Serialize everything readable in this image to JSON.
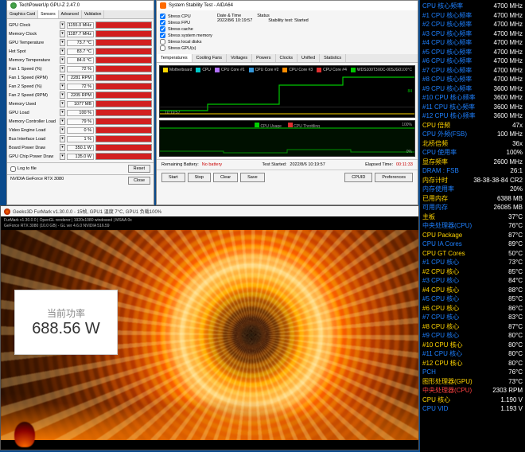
{
  "gpuz": {
    "title": "TechPowerUp GPU-Z 2.47.0",
    "tabs": [
      "Graphics Card",
      "Sensors",
      "Advanced",
      "Validation"
    ],
    "active_tab": 1,
    "rows": [
      {
        "label": "GPU Clock",
        "value": "1155.0 MHz"
      },
      {
        "label": "Memory Clock",
        "value": "1187.7 MHz"
      },
      {
        "label": "GPU Temperature",
        "value": "73.7 °C"
      },
      {
        "label": "Hot Spot",
        "value": "83.7 °C"
      },
      {
        "label": "Memory Temperature",
        "value": "84.0 °C"
      },
      {
        "label": "Fan 1 Speed (%)",
        "value": "72 %"
      },
      {
        "label": "Fan 1 Speed (RPM)",
        "value": "2281 RPM"
      },
      {
        "label": "Fan 2 Speed (%)",
        "value": "72 %"
      },
      {
        "label": "Fan 2 Speed (RPM)",
        "value": "2205 RPM"
      },
      {
        "label": "Memory Used",
        "value": "1077 MB"
      },
      {
        "label": "GPU Load",
        "value": "100 %"
      },
      {
        "label": "Memory Controller Load",
        "value": "79 %"
      },
      {
        "label": "Video Engine Load",
        "value": "0 %"
      },
      {
        "label": "Bus Interface Load",
        "value": "1 %"
      },
      {
        "label": "Board Power Draw",
        "value": "350.1 W"
      },
      {
        "label": "GPU Chip Power Draw",
        "value": "135.0 W"
      }
    ],
    "log_to_file": "Log to file",
    "reset_btn": "Reset",
    "card_name": "NVIDIA GeForce RTX 3080",
    "close_btn": "Close"
  },
  "aida": {
    "title": "System Stability Test - AIDA64",
    "checks": [
      {
        "label": "Stress CPU",
        "checked": true
      },
      {
        "label": "Stress FPU",
        "checked": true
      },
      {
        "label": "Stress cache",
        "checked": true
      },
      {
        "label": "Stress system memory",
        "checked": true
      },
      {
        "label": "Stress local disks",
        "checked": false
      },
      {
        "label": "Stress GPU(s)",
        "checked": false
      }
    ],
    "info": {
      "dt_label": "Date & Time",
      "status_label": "Status",
      "dt_value": "2022/8/6 10:19:57",
      "status_value": "Stability test: Started"
    },
    "tabs": [
      "Temperatures",
      "Cooling Fans",
      "Voltages",
      "Powers",
      "Clocks",
      "Unified",
      "Statistics"
    ],
    "active_tab": 0,
    "graph1": {
      "legend": [
        {
          "color": "sw-yellow",
          "text": "Motherboard"
        },
        {
          "color": "sw-teal",
          "text": "CPU"
        },
        {
          "color": "sw-purple",
          "text": "CPU Core #1"
        },
        {
          "color": "sw-blue",
          "text": "CPU Core #2"
        },
        {
          "color": "sw-orange",
          "text": "CPU Core #3"
        },
        {
          "color": "sw-red",
          "text": "CPU Core #4"
        },
        {
          "color": "sw-green",
          "text": "WDS100T3X0C-00SJG0"
        }
      ],
      "ymax": "100°C",
      "ymid": "64",
      "ymid2": "37",
      "ytick": "10:19:57",
      "yval_right": "84"
    },
    "graph2": {
      "center": [
        "CPU Usage",
        "CPU Throttling"
      ],
      "ymax": "100%",
      "ymin": "0%"
    },
    "status": {
      "battery_label": "Remaining Battery:",
      "battery_value": "No battery",
      "test_started_label": "Test Started:",
      "test_started_value": "2022/8/6 10:19:57",
      "elapsed_label": "Elapsed Time:",
      "elapsed_value": "00:11:33"
    },
    "buttons": [
      "Start",
      "Stop",
      "Clear",
      "Save",
      "CPUID",
      "Preferences"
    ]
  },
  "furmark": {
    "title": "Geeks3D FurMark v1.30.0.0 - 15帧, GPU1 温度 7°C, GPU1 负载100%",
    "sub1": "FurMark v1.30.0.0 | OpenGL renderer | 1920x1080 windowed | MSAA 0x",
    "sub2": "GeForce RTX 3080 (10.0 GB) - GL ver 4.6.0 NVIDIA 516.59"
  },
  "power": {
    "label": "当前功率",
    "value": "688.56 W"
  },
  "rcol": [
    {
      "cls": "",
      "label": "CPU 核心频率",
      "value": "4700 MHz"
    },
    {
      "cls": "",
      "label": "#1 CPU 核心频率",
      "value": "4700 MHz"
    },
    {
      "cls": "",
      "label": "#2 CPU 核心频率",
      "value": "4700 MHz"
    },
    {
      "cls": "",
      "label": "#3 CPU 核心频率",
      "value": "4700 MHz"
    },
    {
      "cls": "",
      "label": "#4 CPU 核心频率",
      "value": "4700 MHz"
    },
    {
      "cls": "",
      "label": "#5 CPU 核心频率",
      "value": "4700 MHz"
    },
    {
      "cls": "",
      "label": "#6 CPU 核心频率",
      "value": "4700 MHz"
    },
    {
      "cls": "",
      "label": "#7 CPU 核心频率",
      "value": "4700 MHz"
    },
    {
      "cls": "",
      "label": "#8 CPU 核心频率",
      "value": "4700 MHz"
    },
    {
      "cls": "",
      "label": "#9 CPU 核心频率",
      "value": "3600 MHz"
    },
    {
      "cls": "",
      "label": "#10 CPU 核心频率",
      "value": "3600 MHz"
    },
    {
      "cls": "",
      "label": "#11 CPU 核心频率",
      "value": "3600 MHz"
    },
    {
      "cls": "",
      "label": "#12 CPU 核心频率",
      "value": "3600 MHz"
    },
    {
      "cls": "y",
      "label": "CPU 倍频",
      "value": "47x"
    },
    {
      "cls": "",
      "label": "CPU 外频(FSB)",
      "value": "100 MHz"
    },
    {
      "cls": "y",
      "label": "北桥倍频",
      "value": "36x"
    },
    {
      "cls": "",
      "label": "CPU 使用率",
      "value": "100%"
    },
    {
      "cls": "y",
      "label": "显存频率",
      "value": "2600 MHz"
    },
    {
      "cls": "",
      "label": "DRAM : FSB",
      "value": "26:1"
    },
    {
      "cls": "y",
      "label": "内存计时",
      "value": "38-38-38-84 CR2"
    },
    {
      "cls": "",
      "label": "内存使用率",
      "value": "20%"
    },
    {
      "cls": "y",
      "label": "已用内存",
      "value": "6388 MB"
    },
    {
      "cls": "",
      "label": "可用内存",
      "value": "26085 MB"
    },
    {
      "cls": "y",
      "label": "主板",
      "value": "37°C"
    },
    {
      "cls": "",
      "label": "中央处理器(CPU)",
      "value": "76°C"
    },
    {
      "cls": "y",
      "label": "CPU Package",
      "value": "87°C"
    },
    {
      "cls": "",
      "label": "CPU IA Cores",
      "value": "89°C"
    },
    {
      "cls": "y",
      "label": "CPU GT Cores",
      "value": "50°C"
    },
    {
      "cls": "",
      "label": "#1 CPU 核心",
      "value": "73°C"
    },
    {
      "cls": "y",
      "label": "#2 CPU 核心",
      "value": "85°C"
    },
    {
      "cls": "",
      "label": "#3 CPU 核心",
      "value": "84°C"
    },
    {
      "cls": "y",
      "label": "#4 CPU 核心",
      "value": "88°C"
    },
    {
      "cls": "",
      "label": "#5 CPU 核心",
      "value": "85°C"
    },
    {
      "cls": "y",
      "label": "#6 CPU 核心",
      "value": "86°C"
    },
    {
      "cls": "",
      "label": "#7 CPU 核心",
      "value": "83°C"
    },
    {
      "cls": "y",
      "label": "#8 CPU 核心",
      "value": "87°C"
    },
    {
      "cls": "",
      "label": "#9 CPU 核心",
      "value": "80°C"
    },
    {
      "cls": "y",
      "label": "#10 CPU 核心",
      "value": "80°C"
    },
    {
      "cls": "",
      "label": "#11 CPU 核心",
      "value": "80°C"
    },
    {
      "cls": "y",
      "label": "#12 CPU 核心",
      "value": "80°C"
    },
    {
      "cls": "",
      "label": "PCH",
      "value": "76°C"
    },
    {
      "cls": "y",
      "label": "图形处理器(GPU)",
      "value": "73°C"
    },
    {
      "cls": "r",
      "label": "中央处理器(CPU)",
      "value": "2303 RPM"
    },
    {
      "cls": "y",
      "label": "CPU 核心",
      "value": "1.190 V"
    },
    {
      "cls": "",
      "label": "CPU VID",
      "value": "1.193 V"
    }
  ]
}
